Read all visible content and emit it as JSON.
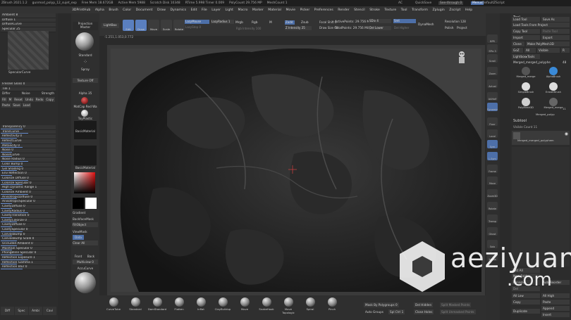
{
  "titlebar": {
    "app": "ZBrush 2021.1.2",
    "file": "gunmod_polyp_12_sujet_exp",
    "free_mem": "Free Mem 18.672GB",
    "active_mem": "Active Mem 5988",
    "scratch_disk": "Scratch Disk 10348",
    "rtime": "RTime 5.998 Timer 0.009",
    "polycount": "PolyCount 29.756 MP",
    "meshcount": "MeshCount 1",
    "ac": "AC",
    "quicksave": "QuickSave",
    "see_through": "See-through 0",
    "menus": "Menus",
    "default_script": "DefaultZScript"
  },
  "menubar": [
    "Alpha",
    "Brush",
    "Color",
    "Document",
    "Draw",
    "Dynamics",
    "Edit",
    "File",
    "Layer",
    "Light",
    "Macro",
    "Marker",
    "Material",
    "Movie",
    "Picker",
    "Preferences",
    "Render",
    "Stencil",
    "Stroke",
    "Texture",
    "Tool",
    "Transform",
    "Zplugin",
    "Zscript",
    "Help"
  ],
  "menubar_prefix": [
    "3DPrintHub",
    "Alpha"
  ],
  "left_panel": {
    "top_rows": [
      "Ambient 8",
      "Diffuse 1",
      "DiffuseCurve",
      "Specular 25"
    ],
    "specular_curve": "SpecularCurve",
    "mid_rows": [
      "Fresnel Gloss 0",
      "Tile 1"
    ],
    "shader_labels": [
      "Differ",
      "Noise",
      "Strength"
    ],
    "small_buttons": [
      "Fill",
      "M",
      "Reset",
      "Undo",
      "Redo",
      "Copy",
      "Paste",
      "Save",
      "Load"
    ],
    "rows": [
      "Transparency 0",
      "TransCurve",
      "Reflectivity 0",
      "ReflectCurve",
      "Metalicity 0",
      "Noise 0",
      "NoiseCurve",
      "Noise Radius 0",
      "Color Bump 0",
      "Gel Shading 0",
      "Env Reflection 0",
      "Colorize Diffuse 0",
      "Colorize Specular 0",
      "High Dynamic Range 1",
      "Colorize Ambient 0",
      "AnisotropicDiffuse 0",
      "AnisotropicSpecular 0",
      "CavityDiffuse 0",
      "CavityRadius 0",
      "CavityTransition 0",
      "CavityColorize 0",
      "CavityDiffuse 0",
      "CavitySpecular 0",
      "CanvasBump 0",
      "CanvasBump Scale 0",
      "Occluded Ambient 0",
      "Maintain Specular 0",
      "PhongBlinn Specular 0",
      "Reflection Exposure 1",
      "Reflection Gamma 1",
      "Reflection Blur 0"
    ],
    "bottom_tabs": [
      "Diff",
      "Spec",
      "Ambi",
      "Cavi"
    ],
    "fill_levels": [
      0.4,
      0.5,
      0.3,
      0.2,
      0.4,
      0.2,
      0.2,
      0.5,
      0.4,
      0.3,
      0.2,
      0.5,
      0.4,
      0.2,
      0.5,
      0.3,
      0.2,
      0.2,
      0.5,
      0.2,
      0.3,
      0.2,
      0.4,
      0.2,
      0.3,
      0.3,
      0.2,
      0.4,
      0.5,
      0.3,
      0.4
    ]
  },
  "toolstrip": {
    "projection_master": "Projection Master",
    "lightbox": "LightBox",
    "standard": "Standard",
    "spray": "Spray",
    "texture_off": "Texture Off",
    "alpha": "Alpha 35",
    "matcap": "MatCap Red Wa",
    "toy_plastic": "ToyPlastic",
    "basic_material": "BasicMaterial",
    "basic_material2": "BasicMaterial",
    "gradient": "Gradient",
    "backface_mask": "BackfaceMask",
    "fill_object": "FillObject",
    "viewmask": "ViewMask",
    "data": "Data",
    "clear_all": "Clear All",
    "front": "Front",
    "back": "Back",
    "multiview": "Multiview 0",
    "accucurve": "AccuCurve"
  },
  "topbar": {
    "edit": "Edit",
    "draw": "Draw",
    "move": "Move",
    "scale": "Scale",
    "rotate": "Rotate",
    "lazymouse": "LazyMouse",
    "lazyradius": "LazyRadius 1",
    "lazystep": "LazyStep 0",
    "mrgb": "Mrgb",
    "rgb": "Rgb",
    "m": "M",
    "zadd": "Zadd",
    "zsub": "Zsub",
    "rgb_intensity": "Rgb Intensity 100",
    "z_intensity": "Z Intensity 25",
    "focal_shift": "Focal Shift 0",
    "draw_size": "Draw Size 64",
    "active_points": "ActivePoints: 29.756 Mil",
    "total_points": "TotalPoints: 29.756 Mil",
    "sdiv": "SDiv 4",
    "smt": "Smt",
    "del_lower": "Del Lower",
    "del_higher": "Del Higher",
    "dynamesh": "DynaMesh",
    "resolution": "Resolution 128",
    "polish": "Polish",
    "project": "Project",
    "coords": "-1.251,1.053,0.772"
  },
  "rightstrip": [
    "BPR",
    "SPix 3",
    "Scroll",
    "Zoom",
    "Actual",
    "AAHalf",
    "Dynamic Persp",
    "Floor",
    "Local",
    "Sym",
    "L.Sym",
    "Frame",
    "Move",
    "Zoom3D",
    "Rotate",
    "Transp",
    "Ghost",
    "Solo",
    "Xpose"
  ],
  "right_panel": {
    "tool": "Tool",
    "load_tool": "Load Tool",
    "save_as": "Save As",
    "load_from_project": "Load Tools From Project",
    "copy_tool": "Copy Tool",
    "paste_tool": "Paste Tool",
    "import": "Import",
    "export": "Export",
    "clone": "Clone",
    "make_polymesh": "Make PolyMesh3D",
    "goz": "GoZ",
    "all": "All",
    "visible": "Visible",
    "r": "R",
    "lightbox_tools": "Lightbox▸Tools",
    "current_tool": "Merged_merged_polyphe",
    "count": "48",
    "thumbs": [
      "Merged_merge",
      "AlphaBrush",
      "SimpleBrush",
      "EraserBrush",
      "PolyMesh3D",
      "Merged_merge",
      "Merged_polyp"
    ],
    "thumb_count": "11",
    "subtool": "Subtool",
    "visible_count": "Visible Count 11",
    "subtool_item": "Merged_merged_polyphem",
    "list_all": "List All",
    "new_folder": "New Folder",
    "rename": "Rename",
    "auto_reorder": "AutoReorder",
    "all_low": "All Low",
    "all_high": "All High",
    "copy": "Copy",
    "paste": "Paste",
    "append": "Append",
    "duplicate": "Duplicate",
    "insert": "Insert",
    "del": "Del"
  },
  "bottombar": {
    "brushes": [
      "CurveTube",
      "Standard",
      "DamStandard",
      "Flatten",
      "Inflat",
      "ClayBuildup",
      "Move",
      "SnakeHook",
      "Move Topologic",
      "Spiral",
      "Pinch"
    ],
    "mask_by_polygroups": "Mask By Polygroups 0",
    "auto_groups": "Auto Groups",
    "split_unmasked": "Spl Ctrl 1",
    "del_hidden": "Del Hidden",
    "close_holes": "Close Holes",
    "split_masked": "Split Masked Points",
    "split_unmasked_points": "Split Unmasked Points"
  },
  "watermark": {
    "line1": "aeziyuan",
    "line2": ".com"
  },
  "colors": {
    "accent": "#5a7fbf",
    "panel": "#2c2c2c",
    "viewport": "#3f3f3f"
  }
}
